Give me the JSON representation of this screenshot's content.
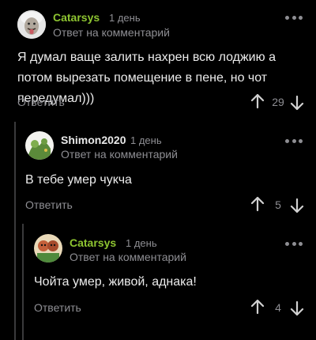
{
  "comments": [
    {
      "author": "Catarsys",
      "author_color": "#8ec531",
      "time": "1 день",
      "reply_to": "Ответ на комментарий",
      "text": "Я думал ваще залить нахрен всю лоджию а потом вырезать помещение в пене, но чот передумал)))",
      "reply_label": "Ответить",
      "score": "29"
    },
    {
      "author": "Shimon2020",
      "author_color": "#e8e8e8",
      "time": "1 день",
      "reply_to": "Ответ на комментарий",
      "text": "В тебе умер чукча",
      "reply_label": "Ответить",
      "score": "5"
    },
    {
      "author": "Catarsys",
      "author_color": "#8ec531",
      "time": "1 день",
      "reply_to": "Ответ на комментарий",
      "text": "Чойта умер, живой, аднака!",
      "reply_label": "Ответить",
      "score": "4"
    }
  ],
  "colors": {
    "background": "#000000",
    "muted": "#8e8e93",
    "thread_line": "#3a3a3c",
    "accent_green": "#8ec531"
  },
  "icons": {
    "upvote": "arrow-up-icon",
    "downvote": "arrow-down-icon",
    "more": "more-dots-icon"
  }
}
